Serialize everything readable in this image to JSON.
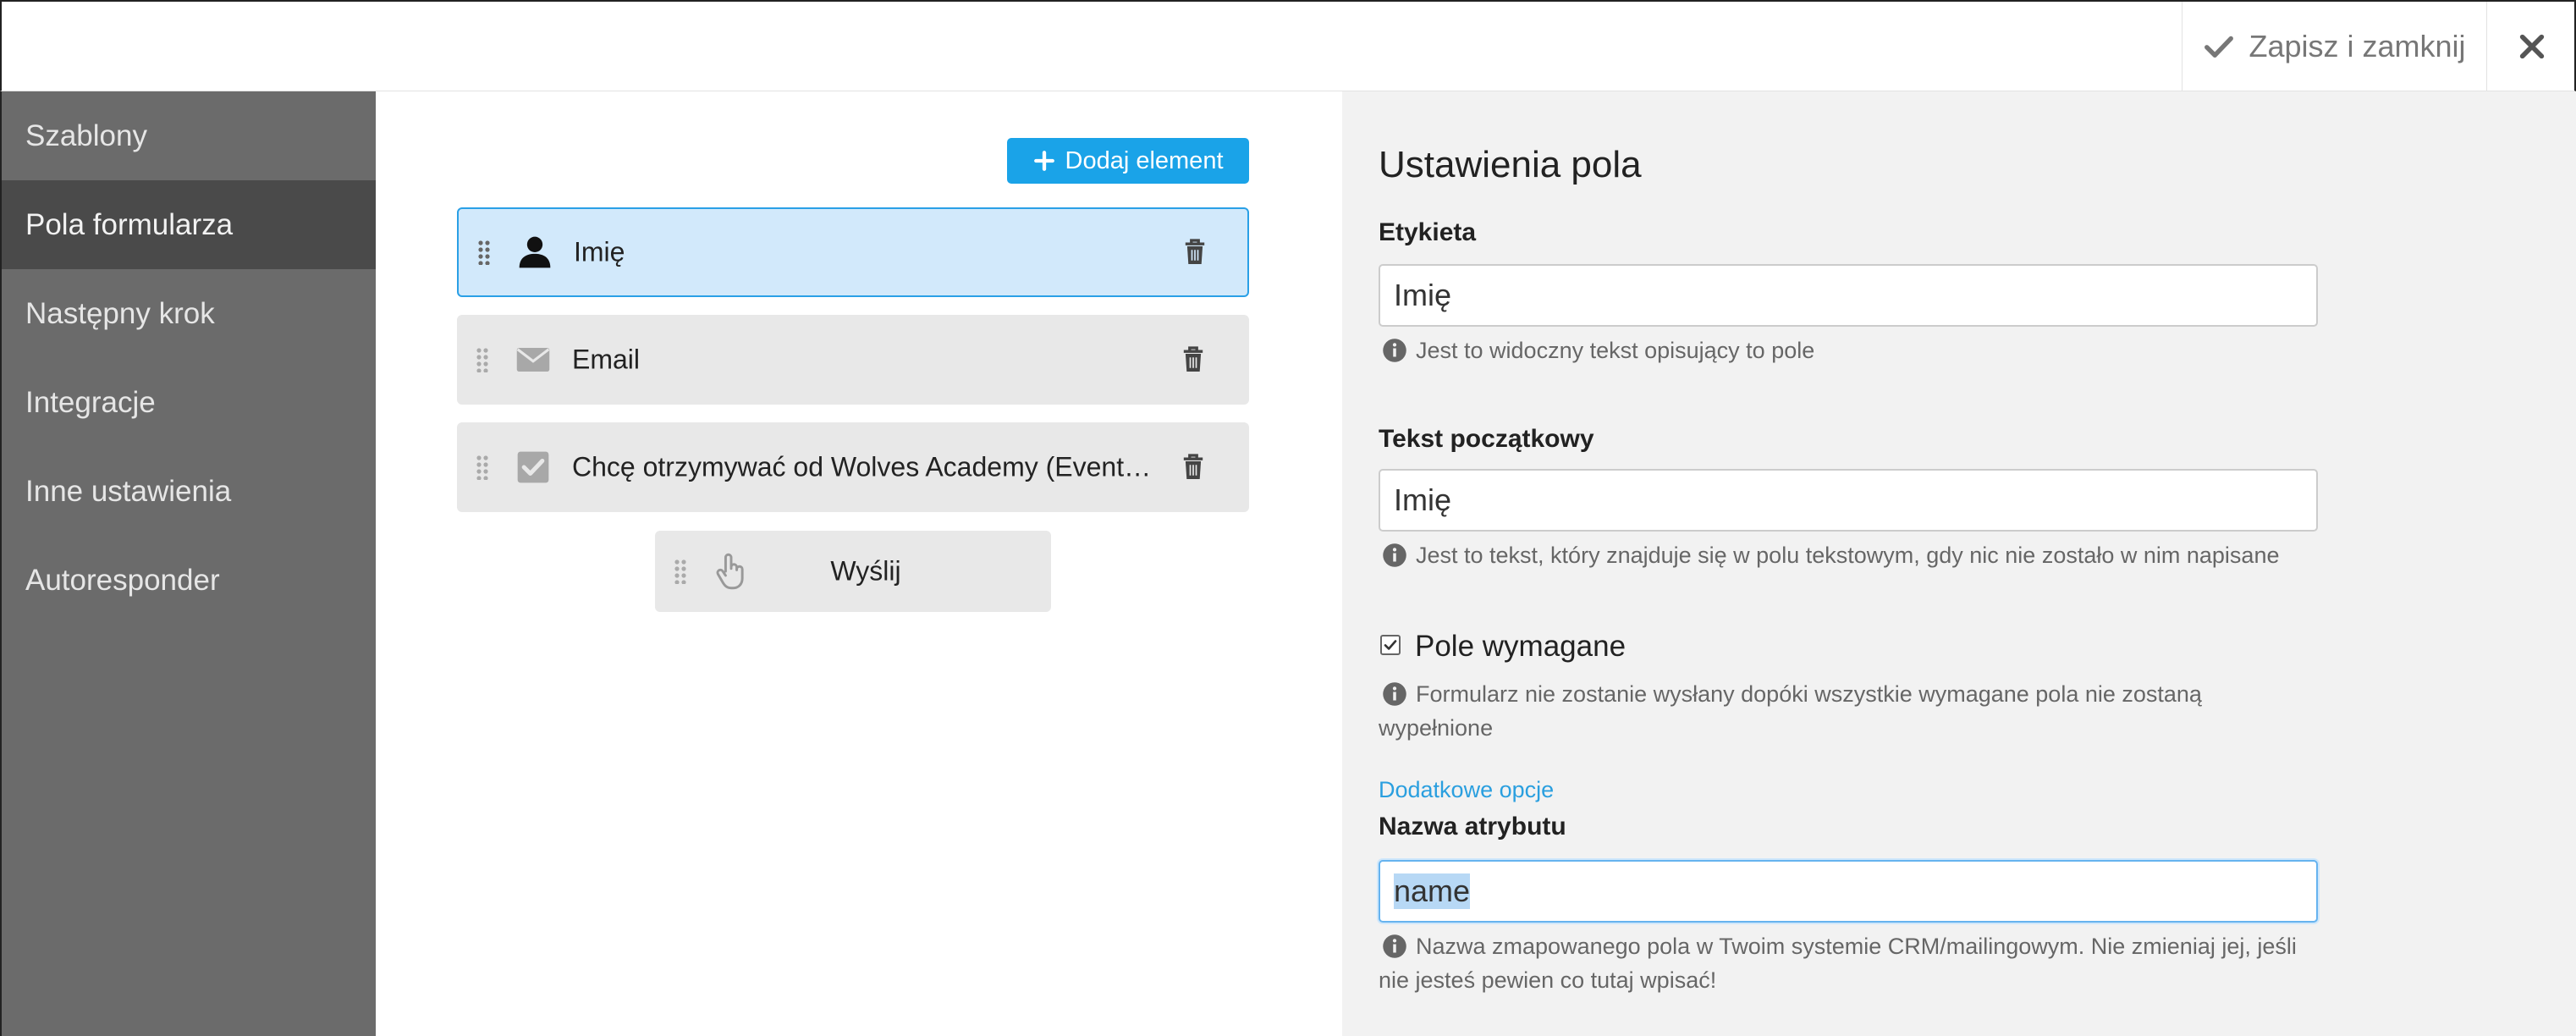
{
  "header": {
    "save_label": "Zapisz i zamknij"
  },
  "sidebar": {
    "items": [
      {
        "label": "Szablony"
      },
      {
        "label": "Pola formularza"
      },
      {
        "label": "Następny krok"
      },
      {
        "label": "Integracje"
      },
      {
        "label": "Inne ustawienia"
      },
      {
        "label": "Autoresponder"
      }
    ],
    "active_index": 1
  },
  "builder": {
    "add_label": "Dodaj element",
    "fields": [
      {
        "label": "Imię",
        "icon": "user-icon",
        "selected": true
      },
      {
        "label": "Email",
        "icon": "envelope-icon",
        "selected": false
      },
      {
        "label": "Chcę otrzymywać od Wolves Academy (Eventlabs…",
        "icon": "checkbox-icon",
        "selected": false
      }
    ],
    "submit_label": "Wyślij"
  },
  "settings": {
    "title": "Ustawienia pola",
    "label_title": "Etykieta",
    "label_value": "Imię",
    "label_help": "Jest to widoczny tekst opisujący to pole",
    "placeholder_title": "Tekst początkowy",
    "placeholder_value": "Imię",
    "placeholder_help": "Jest to tekst, który znajduje się w polu tekstowym, gdy nic nie zostało w nim napisane",
    "required_label": "Pole wymagane",
    "required_checked": true,
    "required_help": "Formularz nie zostanie wysłany dopóki wszystkie wymagane pola nie zostaną wypełnione",
    "more_options": "Dodatkowe opcje",
    "attribute_title": "Nazwa atrybutu",
    "attribute_value": "name",
    "attribute_help": "Nazwa zmapowanego pola w Twoim systemie CRM/mailingowym. Nie zmieniaj jej, jeśli nie jesteś pewien co tutaj wpisać!"
  },
  "colors": {
    "accent": "#1aa3e8",
    "sidebar_bg": "#6b6b6b",
    "sidebar_active": "#4a4a4a",
    "selected_bg": "#d2e9fb",
    "panel_bg": "#f2f2f2"
  }
}
